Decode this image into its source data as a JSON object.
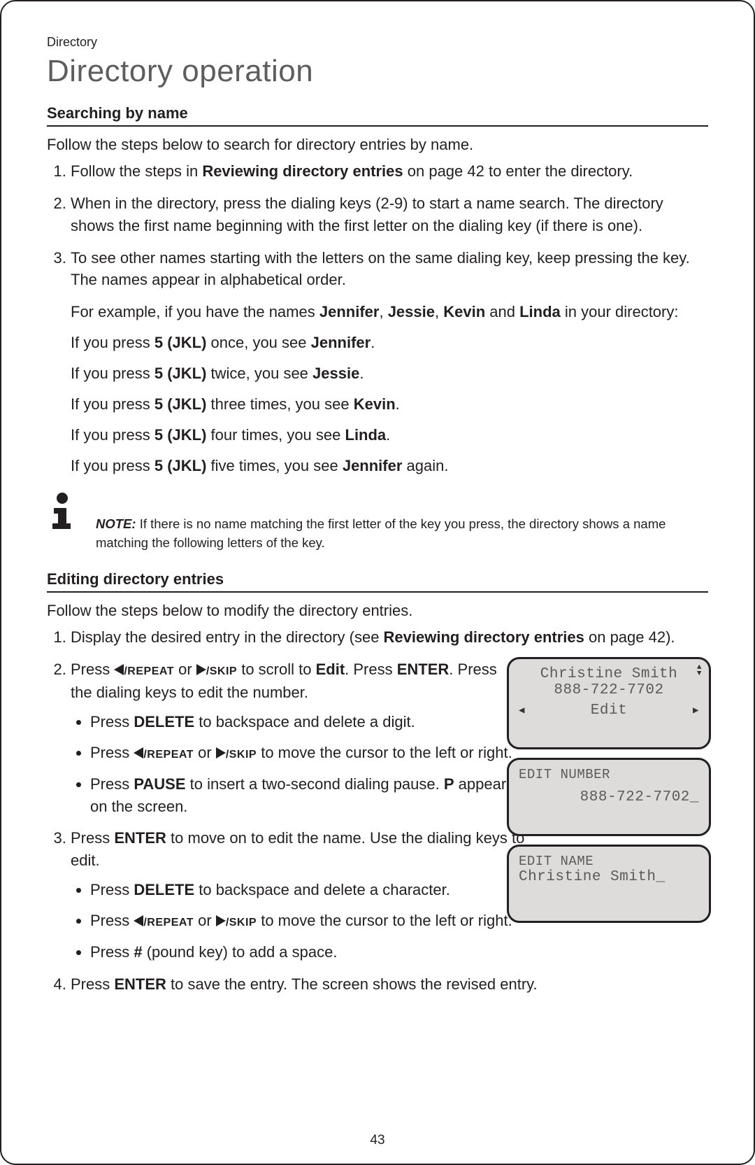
{
  "breadcrumb": "Directory",
  "title": "Directory operation",
  "section1": {
    "heading": "Searching by name",
    "intro": "Follow the steps below to search for directory entries by name.",
    "step1_a": "Follow the steps in ",
    "step1_b": "Reviewing directory entries",
    "step1_c": " on page 42 to enter the directory.",
    "step2": "When in the directory, press the dialing keys (2-9) to start a name search. The directory shows the first name beginning with the first letter on the dialing key (if there is one).",
    "step3_a": "To see other names starting with the letters on the same dialing key, keep pressing the key. The names appear in alphabetical order.",
    "step3_ex_intro_a": "For example, if you have the names ",
    "name_jennifer": "Jennifer",
    "name_jessie": "Jessie",
    "name_kevin": "Kevin",
    "name_linda": "Linda",
    "step3_ex_intro_b": " in your directory:",
    "ex1_a": "If you press ",
    "key5": "5 (JKL)",
    "ex1_b": " once, you see ",
    "ex1_c": ".",
    "ex2_b": " twice, you see ",
    "ex3_b": " three times, you see ",
    "ex4_b": " four times, you see ",
    "ex5_b": " five times, you see ",
    "ex5_c": " again.",
    "note_label": "NOTE:",
    "note_text": " If there is no name matching the first letter of the key you press, the directory shows a name matching the following letters of the key."
  },
  "section2": {
    "heading": "Editing directory entries",
    "intro": "Follow the steps below to modify the directory entries.",
    "step1_a": "Display the desired entry in the directory (see ",
    "step1_b": "Reviewing directory entries",
    "step1_c": " on page 42).",
    "step2_a": "Press ",
    "repeat_label": "/REPEAT",
    "or": " or ",
    "skip_label": "/SKIP",
    "step2_b": " to scroll to ",
    "edit_word": "Edit",
    "step2_c": ". Press ",
    "enter_word": "ENTER",
    "step2_d": ". Press the dialing keys to edit the number.",
    "b1_a": "Press ",
    "delete_word": "DELETE",
    "b1_b": " to backspace and delete a digit.",
    "b2_b": " to move the cursor to the left or right.",
    "b3_a": "Press ",
    "pause_word": "PAUSE",
    "b3_b": " to insert a two-second dialing pause. ",
    "p_word": "P",
    "b3_c": " appears on the screen.",
    "step3_a": "Press ",
    "step3_b": " to move on to edit the name. Use the dialing keys to edit.",
    "b4_b": " to backspace and delete a character.",
    "b6_a": "Press ",
    "hash_word": "#",
    "b6_b": " (pound key) to add a space.",
    "step4_a": "Press ",
    "step4_b": " to save the entry. The screen shows the revised entry."
  },
  "screens": {
    "s1_name": "Christine Smith",
    "s1_num": "888-722-7702",
    "s1_action": "Edit",
    "s2_title": "EDIT NUMBER",
    "s2_num": "888-722-7702_",
    "s3_title": "EDIT NAME",
    "s3_name": "Christine Smith_"
  },
  "page_number": "43",
  "glyphs": {
    "comma_sp": ", ",
    "and_sp": " and "
  }
}
